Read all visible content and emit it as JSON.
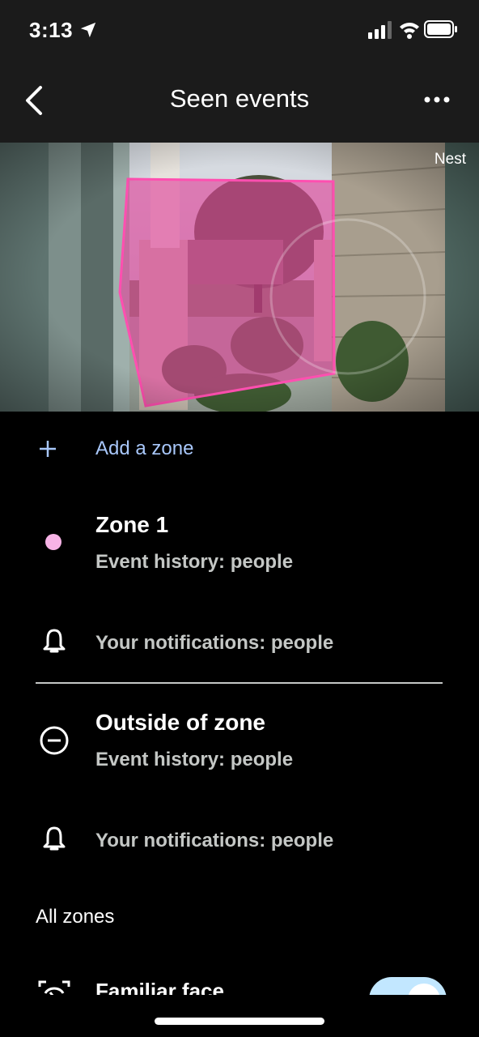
{
  "status_bar": {
    "time": "3:13"
  },
  "header": {
    "title": "Seen events"
  },
  "camera": {
    "brand_label": "Nest"
  },
  "add_zone": {
    "label": "Add a zone"
  },
  "zones": [
    {
      "title": "Zone 1",
      "event_history": "Event history: people",
      "notifications": "Your notifications: people",
      "dot_color": "#f7b3e6"
    },
    {
      "title": "Outside of zone",
      "event_history": "Event history: people",
      "notifications": "Your notifications: people"
    }
  ],
  "all_zones": {
    "heading": "All zones",
    "familiar_face": "Familiar face"
  },
  "colors": {
    "accent_link": "#a8c7fa",
    "zone_overlay": "#e0409a",
    "toggle_track": "#c2e7ff"
  }
}
